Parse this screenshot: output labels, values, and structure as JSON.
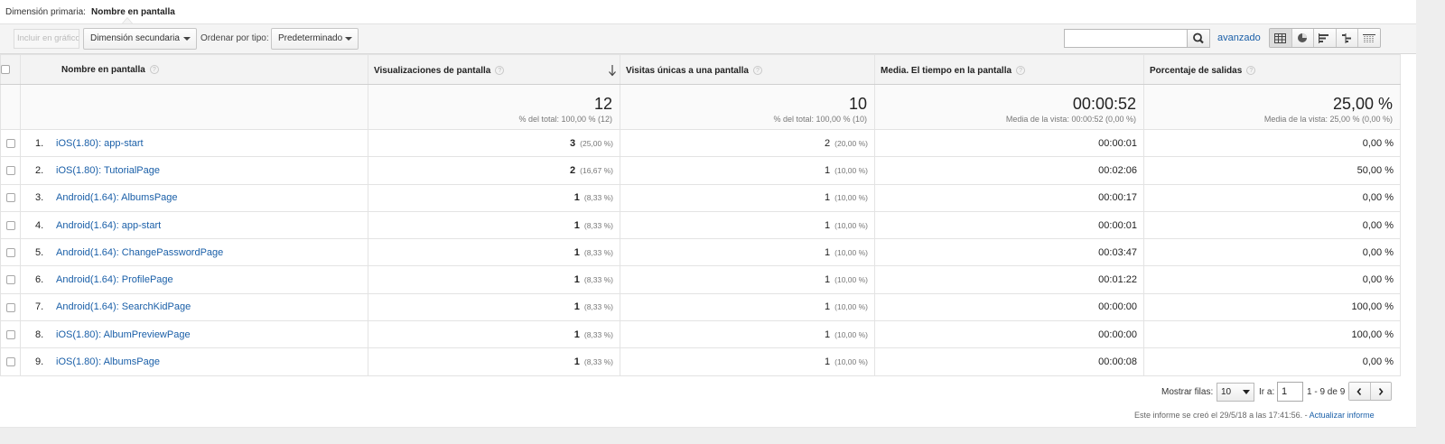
{
  "primary": {
    "label": "Dimensión primaria:",
    "value": "Nombre en pantalla"
  },
  "toolbar": {
    "include_chart": "Incluir en gráfico",
    "secondary_dimension": "Dimensión secundaria",
    "order_label": "Ordenar por tipo:",
    "order_value": "Predeterminado",
    "search_value": "",
    "advanced": "avanzado",
    "view_icons": [
      "table-view-icon",
      "pie-view-icon",
      "performance-view-icon",
      "comparison-view-icon",
      "pivot-view-icon"
    ]
  },
  "table": {
    "headers": {
      "name": "Nombre en pantalla",
      "views": "Visualizaciones de pantalla",
      "unique": "Visitas únicas a una pantalla",
      "time": "Media. El tiempo en la pantalla",
      "exit": "Porcentaje de salidas"
    },
    "help_glyph": "?",
    "totals": {
      "views": "12",
      "views_sub": "% del total: 100,00 % (12)",
      "unique": "10",
      "unique_sub": "% del total: 100,00 % (10)",
      "time": "00:00:52",
      "time_sub": "Media de la vista: 00:00:52 (0,00 %)",
      "exit": "25,00 %",
      "exit_sub": "Media de la vista: 25,00 % (0,00 %)"
    },
    "rows": [
      {
        "idx": "1.",
        "name": "iOS(1.80): app-start",
        "views": "3",
        "views_pct": "(25,00 %)",
        "unique": "2",
        "unique_pct": "(20,00 %)",
        "time": "00:00:01",
        "exit": "0,00 %"
      },
      {
        "idx": "2.",
        "name": "iOS(1.80): TutorialPage",
        "views": "2",
        "views_pct": "(16,67 %)",
        "unique": "1",
        "unique_pct": "(10,00 %)",
        "time": "00:02:06",
        "exit": "50,00 %"
      },
      {
        "idx": "3.",
        "name": "Android(1.64): AlbumsPage",
        "views": "1",
        "views_pct": "(8,33 %)",
        "unique": "1",
        "unique_pct": "(10,00 %)",
        "time": "00:00:17",
        "exit": "0,00 %"
      },
      {
        "idx": "4.",
        "name": "Android(1.64): app-start",
        "views": "1",
        "views_pct": "(8,33 %)",
        "unique": "1",
        "unique_pct": "(10,00 %)",
        "time": "00:00:01",
        "exit": "0,00 %"
      },
      {
        "idx": "5.",
        "name": "Android(1.64): ChangePasswordPage",
        "views": "1",
        "views_pct": "(8,33 %)",
        "unique": "1",
        "unique_pct": "(10,00 %)",
        "time": "00:03:47",
        "exit": "0,00 %"
      },
      {
        "idx": "6.",
        "name": "Android(1.64): ProfilePage",
        "views": "1",
        "views_pct": "(8,33 %)",
        "unique": "1",
        "unique_pct": "(10,00 %)",
        "time": "00:01:22",
        "exit": "0,00 %"
      },
      {
        "idx": "7.",
        "name": "Android(1.64): SearchKidPage",
        "views": "1",
        "views_pct": "(8,33 %)",
        "unique": "1",
        "unique_pct": "(10,00 %)",
        "time": "00:00:00",
        "exit": "100,00 %"
      },
      {
        "idx": "8.",
        "name": "iOS(1.80): AlbumPreviewPage",
        "views": "1",
        "views_pct": "(8,33 %)",
        "unique": "1",
        "unique_pct": "(10,00 %)",
        "time": "00:00:00",
        "exit": "100,00 %"
      },
      {
        "idx": "9.",
        "name": "iOS(1.80): AlbumsPage",
        "views": "1",
        "views_pct": "(8,33 %)",
        "unique": "1",
        "unique_pct": "(10,00 %)",
        "time": "00:00:08",
        "exit": "0,00 %"
      }
    ]
  },
  "footer": {
    "rows_label": "Mostrar filas:",
    "rows_value": "10",
    "goto_label": "Ir a:",
    "goto_value": "1",
    "range": "1 - 9 de 9",
    "created": "Este informe se creó el 29/5/18 a las 17:41:56. -",
    "refresh": "Actualizar informe"
  },
  "colors": {
    "link": "#1a5fa8",
    "header_bg": "#f3f3f3",
    "toolbar_bg": "#f4f4f4"
  }
}
